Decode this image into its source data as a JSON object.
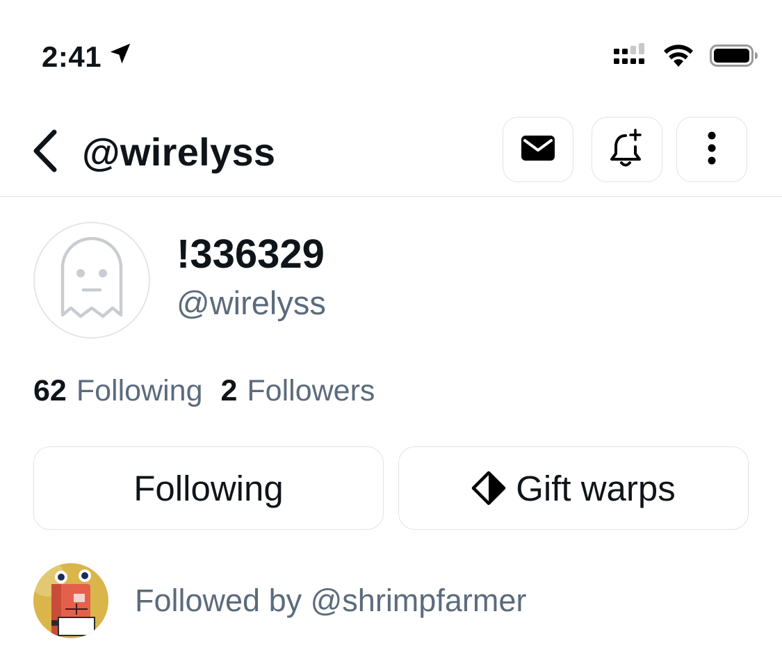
{
  "status_bar": {
    "time": "2:41",
    "icons": [
      "location-arrow-icon",
      "cellular-signal-icon",
      "wifi-icon",
      "battery-icon"
    ]
  },
  "header": {
    "back_icon": "chevron-left-icon",
    "title": "@wirelyss",
    "actions": [
      {
        "name": "message-button",
        "icon": "envelope-icon"
      },
      {
        "name": "notify-button",
        "icon": "bell-plus-icon"
      },
      {
        "name": "more-button",
        "icon": "more-vertical-icon"
      }
    ]
  },
  "profile": {
    "avatar_icon": "ghost-icon",
    "display_name": "!336329",
    "handle": "@wirelyss"
  },
  "stats": {
    "following_count": "62",
    "following_label": "Following",
    "followers_count": "2",
    "followers_label": "Followers"
  },
  "actions": {
    "follow_label": "Following",
    "gift_label": "Gift warps",
    "gift_icon": "diamond-icon"
  },
  "followed_by": {
    "text": "Followed by @shrimpfarmer"
  },
  "colors": {
    "text_primary": "#0f1419",
    "text_secondary": "#5b6b7c",
    "border": "#dfe3e6",
    "ghost": "#c9cdd1"
  }
}
